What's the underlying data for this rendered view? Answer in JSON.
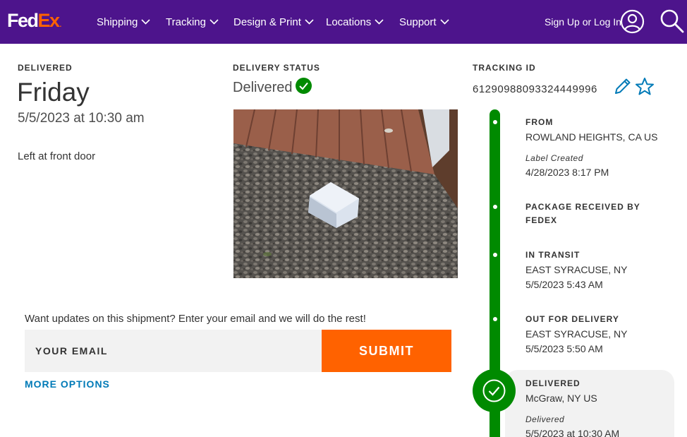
{
  "header": {
    "logo_fed": "Fed",
    "logo_ex": "Ex",
    "logo_dot": ".",
    "nav": [
      {
        "label": "Shipping"
      },
      {
        "label": "Tracking"
      },
      {
        "label": "Design & Print"
      },
      {
        "label": "Locations"
      },
      {
        "label": "Support"
      }
    ],
    "signin_label": "Sign Up or Log In"
  },
  "delivery": {
    "label": "DELIVERED",
    "day": "Friday",
    "datetime": "5/5/2023 at 10:30 am",
    "location_note": "Left at front door"
  },
  "status": {
    "label": "DELIVERY STATUS",
    "value": "Delivered"
  },
  "email_signup": {
    "prompt": "Want updates on this shipment? Enter your email and we will do the rest!",
    "placeholder": "YOUR EMAIL",
    "submit_label": "SUBMIT",
    "more_options_label": "MORE OPTIONS"
  },
  "tracking": {
    "label": "TRACKING ID",
    "id": "612909880933244499​96",
    "events": [
      {
        "title": "FROM",
        "line1": "ROWLAND HEIGHTS, CA US",
        "sub": "Label Created",
        "line2": "4/28/2023 8:17 PM"
      },
      {
        "title": "PACKAGE RECEIVED BY",
        "title2": "FEDEX"
      },
      {
        "title": "IN TRANSIT",
        "line1": "EAST SYRACUSE, NY",
        "line2": "5/5/2023 5:43 AM"
      },
      {
        "title": "OUT FOR DELIVERY",
        "line1": "EAST SYRACUSE, NY",
        "line2": "5/5/2023 5:50 AM"
      },
      {
        "title": "DELIVERED",
        "line1": "McGraw, NY US",
        "sub": "Delivered",
        "line2": "5/5/2023 at 10:30 AM"
      }
    ]
  },
  "colors": {
    "brand_purple": "#4d148c",
    "brand_orange": "#ff6200",
    "success_green": "#008a00",
    "link_blue": "#007ab7"
  }
}
